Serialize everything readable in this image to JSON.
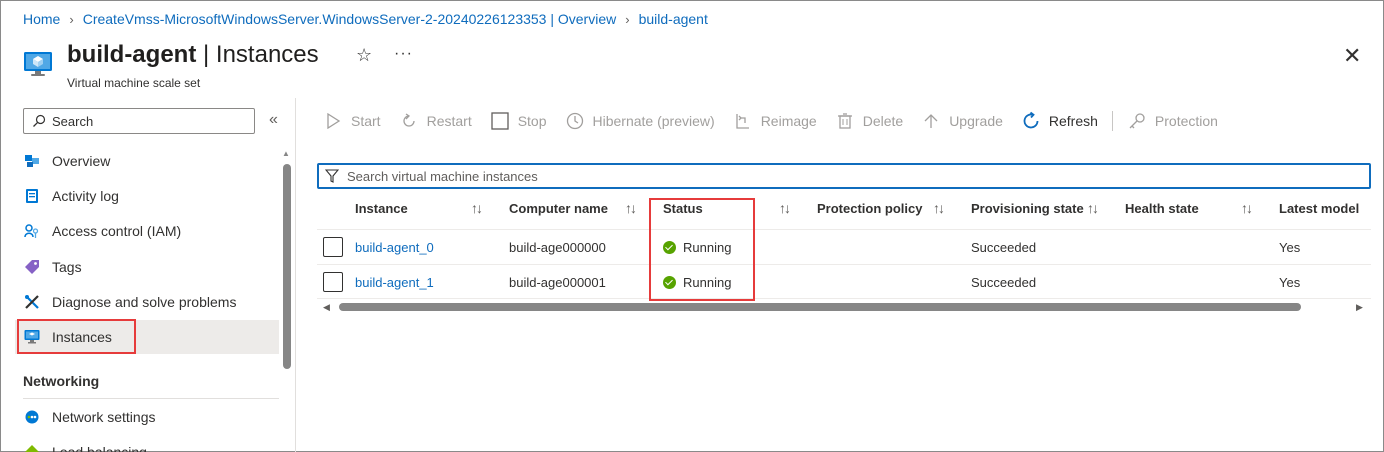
{
  "breadcrumb": {
    "home": "Home",
    "vmss_overview": "CreateVmss-MicrosoftWindowsServer.WindowsServer-2-20240226123353 | Overview",
    "current": "build-agent"
  },
  "header": {
    "resource_name": "build-agent",
    "separator": " | ",
    "page_name": "Instances",
    "subtitle": "Virtual machine scale set",
    "star": "☆",
    "more": "···",
    "close": "✕"
  },
  "sidebar": {
    "search_placeholder": "Search",
    "collapse": "«",
    "items": [
      {
        "label": "Overview",
        "icon": "overview-icon"
      },
      {
        "label": "Activity log",
        "icon": "activity-log-icon"
      },
      {
        "label": "Access control (IAM)",
        "icon": "iam-icon"
      },
      {
        "label": "Tags",
        "icon": "tag-icon"
      },
      {
        "label": "Diagnose and solve problems",
        "icon": "diagnose-icon"
      },
      {
        "label": "Instances",
        "icon": "vm-icon",
        "selected": true
      }
    ],
    "section_heading": "Networking",
    "section_items": [
      {
        "label": "Network settings",
        "icon": "network-icon"
      },
      {
        "label": "Load balancing",
        "icon": "load-balancer-icon"
      }
    ]
  },
  "toolbar": {
    "start": "Start",
    "restart": "Restart",
    "stop": "Stop",
    "hibernate": "Hibernate (preview)",
    "reimage": "Reimage",
    "delete": "Delete",
    "upgrade": "Upgrade",
    "refresh": "Refresh",
    "protection": "Protection"
  },
  "filter": {
    "placeholder": "Search virtual machine instances"
  },
  "grid": {
    "columns": [
      "Instance",
      "Computer name",
      "Status",
      "Protection policy",
      "Provisioning state",
      "Health state",
      "Latest model"
    ],
    "sort_glyph": "↑↓",
    "rows": [
      {
        "instance": "build-agent_0",
        "computer_name": "build-age000000",
        "status": "Running",
        "protection_policy": "",
        "provisioning_state": "Succeeded",
        "health_state": "",
        "latest_model": "Yes"
      },
      {
        "instance": "build-agent_1",
        "computer_name": "build-age000001",
        "status": "Running",
        "protection_policy": "",
        "provisioning_state": "Succeeded",
        "health_state": "",
        "latest_model": "Yes"
      }
    ]
  },
  "colors": {
    "link": "#0f6cbd",
    "status_running": "#57a300",
    "highlight": "#e63b3b"
  }
}
